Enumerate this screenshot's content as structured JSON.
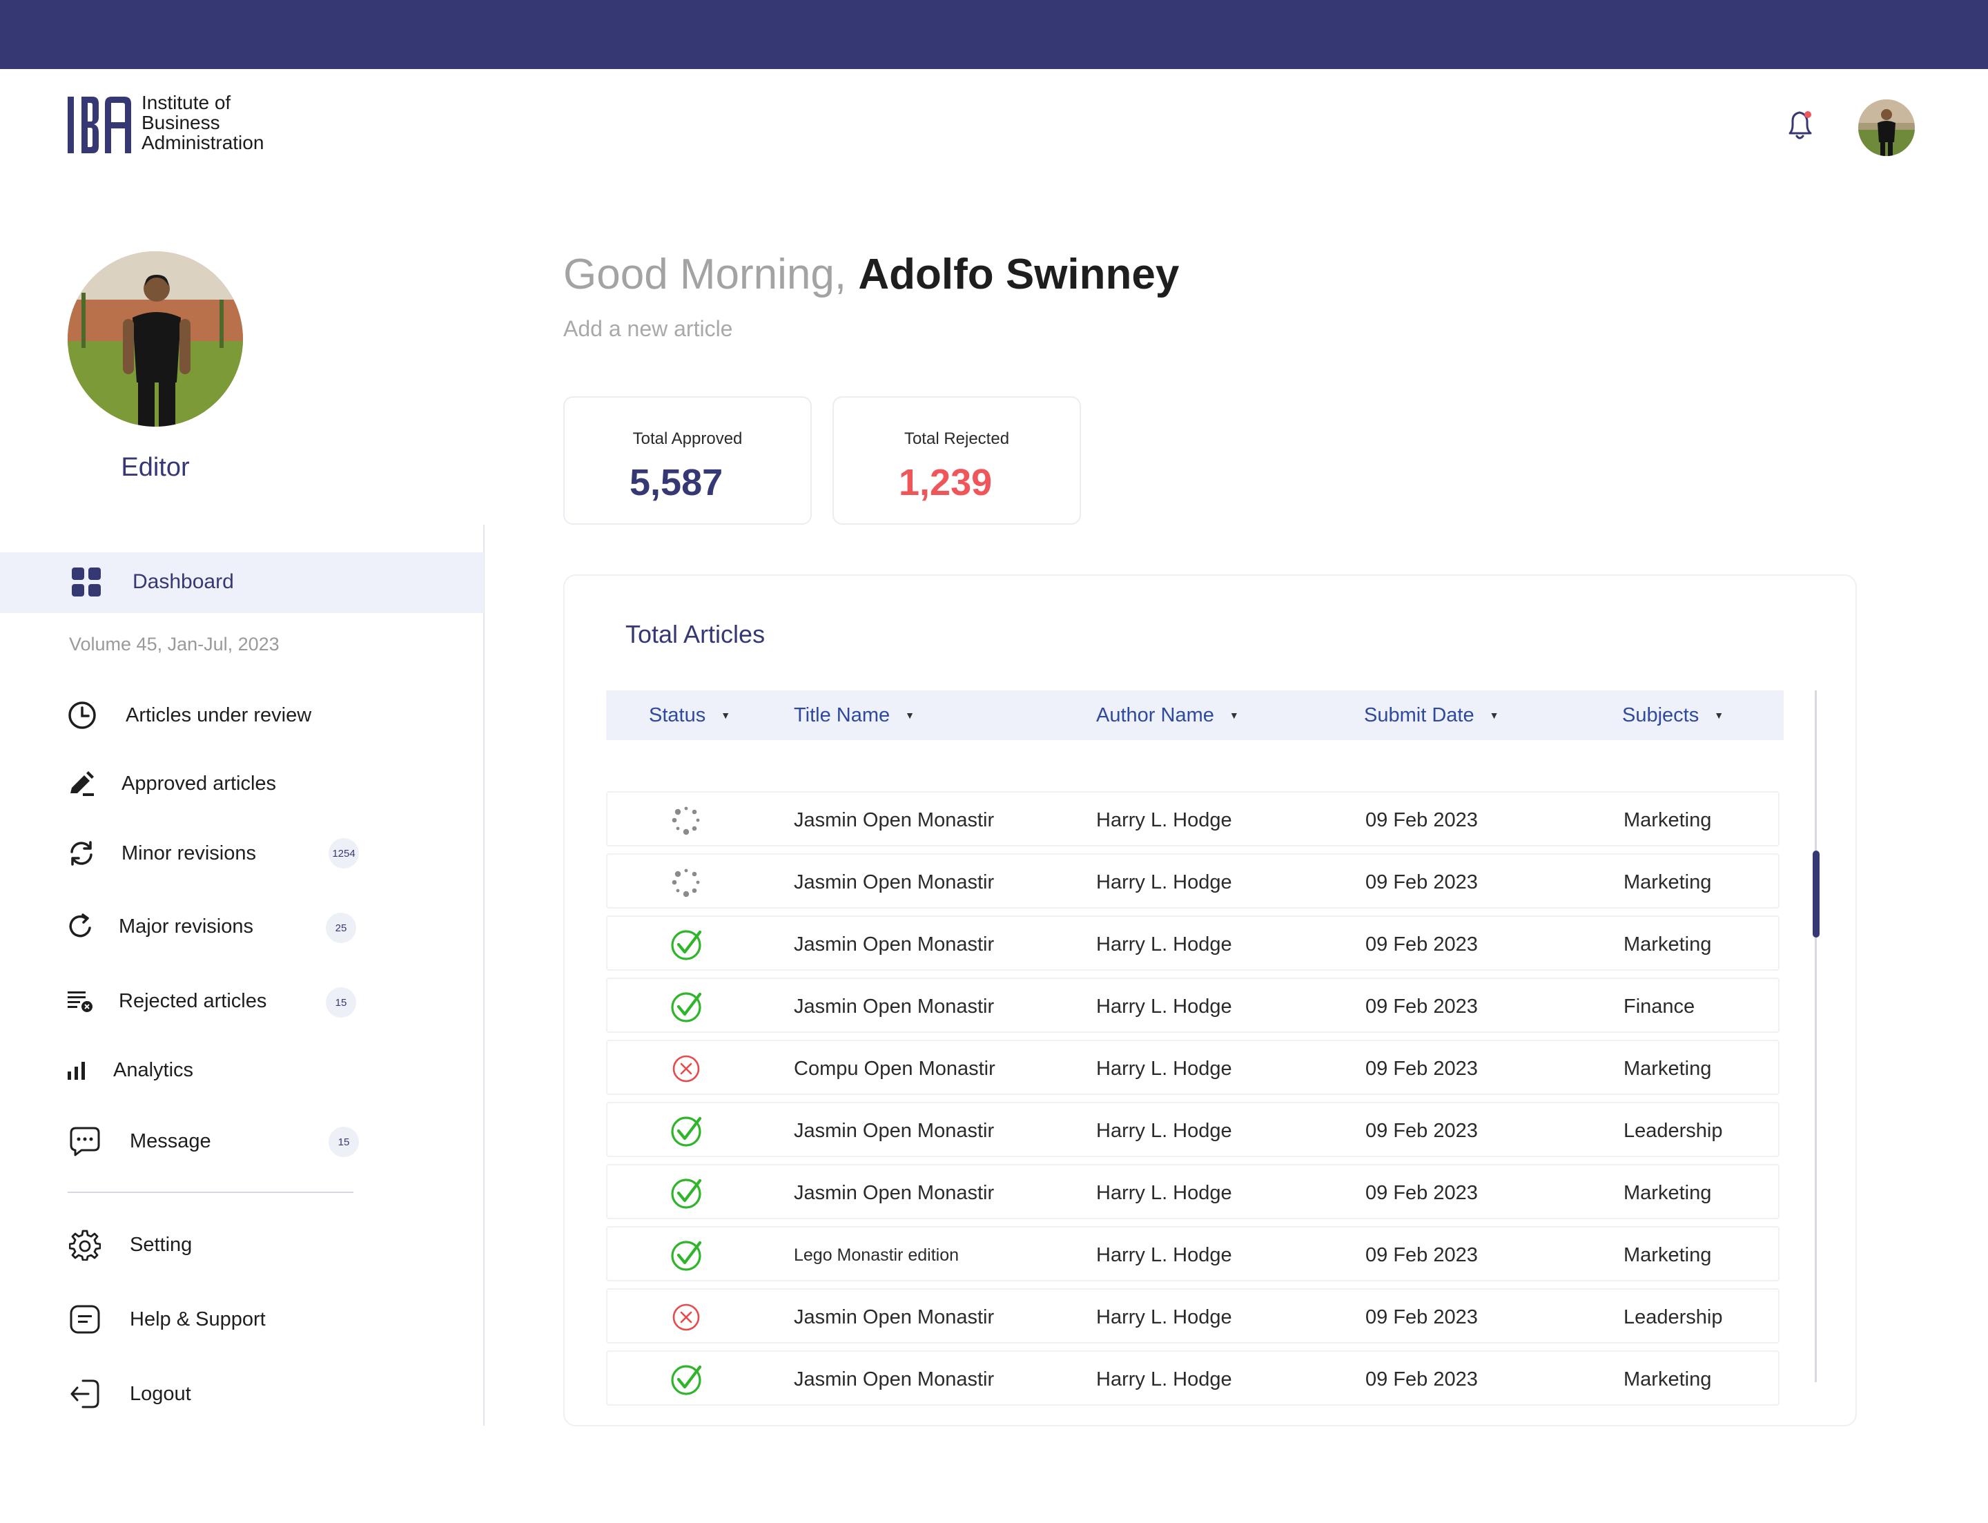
{
  "brand": {
    "logo_mark": "IBA",
    "name_line1": "Institute of",
    "name_line2": "Business",
    "name_line3": "Administration",
    "primary_color": "#363874"
  },
  "header": {
    "notification_icon": "bell-icon",
    "avatar": "user-avatar"
  },
  "profile": {
    "role": "Editor"
  },
  "sidebar": {
    "active": {
      "label": "Dashboard",
      "icon": "grid-icon"
    },
    "volume": "Volume 45, Jan-Jul, 2023",
    "items": [
      {
        "label": "Articles under review",
        "icon": "clock-icon",
        "badge": ""
      },
      {
        "label": "Approved articles",
        "icon": "pen-icon",
        "badge": ""
      },
      {
        "label": "Minor revisions",
        "icon": "refresh-icon",
        "badge": "1254"
      },
      {
        "label": "Major revisions",
        "icon": "rotate-icon",
        "badge": "25"
      },
      {
        "label": "Rejected articles",
        "icon": "list-x-icon",
        "badge": "15"
      },
      {
        "label": "Analytics",
        "icon": "bar-chart-icon",
        "badge": ""
      },
      {
        "label": "Message",
        "icon": "chat-icon",
        "badge": "15"
      }
    ],
    "bottom_items": [
      {
        "label": "Setting",
        "icon": "gear-icon"
      },
      {
        "label": "Help & Support",
        "icon": "note-icon"
      },
      {
        "label": "Logout",
        "icon": "logout-icon"
      }
    ]
  },
  "greeting": {
    "prefix": "Good Morning,",
    "name": "Adolfo Swinney",
    "subtitle": "Add a new article"
  },
  "stats": {
    "approved": {
      "label": "Total Approved",
      "value": "5,587",
      "color": "#363874"
    },
    "rejected": {
      "label": "Total Rejected",
      "value": "1,239",
      "color": "#f0555a"
    }
  },
  "table": {
    "title": "Total Articles",
    "columns": [
      "Status",
      "Title Name",
      "Author Name",
      "Submit Date",
      "Subjects"
    ],
    "rows": [
      {
        "status": "pending",
        "title": "Jasmin Open Monastir",
        "author": "Harry L. Hodge",
        "date": "09 Feb 2023",
        "subject": "Marketing"
      },
      {
        "status": "pending",
        "title": "Jasmin Open Monastir",
        "author": "Harry L. Hodge",
        "date": "09 Feb 2023",
        "subject": "Marketing"
      },
      {
        "status": "approved",
        "title": "Jasmin Open Monastir",
        "author": "Harry L. Hodge",
        "date": "09 Feb 2023",
        "subject": "Marketing"
      },
      {
        "status": "approved",
        "title": "Jasmin Open Monastir",
        "author": "Harry L. Hodge",
        "date": "09 Feb 2023",
        "subject": "Finance"
      },
      {
        "status": "rejected",
        "title": "Compu Open Monastir",
        "author": "Harry L. Hodge",
        "date": "09 Feb 2023",
        "subject": "Marketing"
      },
      {
        "status": "approved",
        "title": "Jasmin Open Monastir",
        "author": "Harry L. Hodge",
        "date": "09 Feb 2023",
        "subject": "Leadership"
      },
      {
        "status": "approved",
        "title": "Jasmin Open Monastir",
        "author": "Harry L. Hodge",
        "date": "09 Feb 2023",
        "subject": "Marketing"
      },
      {
        "status": "approved",
        "title": "Lego Monastir edition",
        "author": "Harry L. Hodge",
        "date": "09 Feb 2023",
        "subject": "Marketing"
      },
      {
        "status": "rejected",
        "title": "Jasmin Open Monastir",
        "author": "Harry L. Hodge",
        "date": "09 Feb 2023",
        "subject": "Leadership"
      },
      {
        "status": "approved",
        "title": "Jasmin Open Monastir",
        "author": "Harry L. Hodge",
        "date": "09 Feb 2023",
        "subject": "Marketing"
      }
    ],
    "status_colors": {
      "approved": "#2fb52a",
      "rejected": "#e84a4a",
      "pending": "#8a8a8a"
    }
  }
}
